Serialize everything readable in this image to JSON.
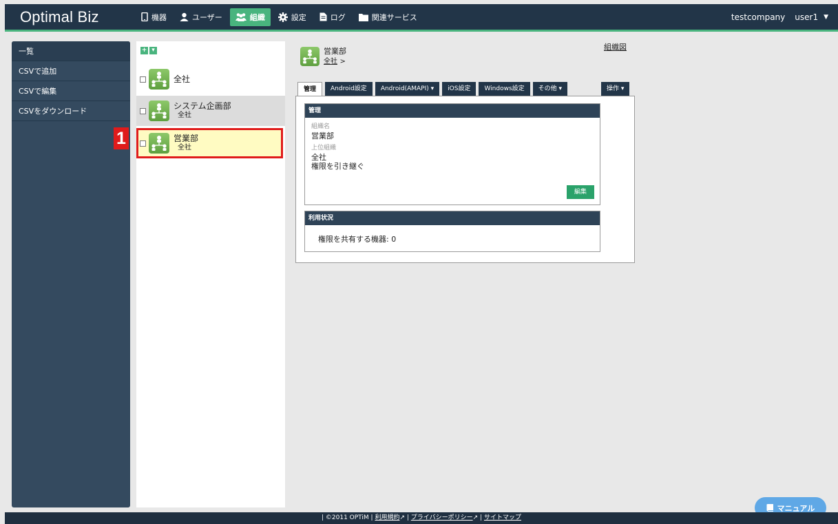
{
  "app": {
    "title": "Optimal Biz"
  },
  "nav": {
    "items": [
      {
        "label": "機器",
        "icon": "phone-icon",
        "active": false
      },
      {
        "label": "ユーザー",
        "icon": "user-icon",
        "active": false
      },
      {
        "label": "組織",
        "icon": "group-icon",
        "active": true
      },
      {
        "label": "設定",
        "icon": "gear-icon",
        "active": false
      },
      {
        "label": "ログ",
        "icon": "document-icon",
        "active": false
      },
      {
        "label": "関連サービス",
        "icon": "folder-icon",
        "active": false
      }
    ]
  },
  "user": {
    "company": "testcompany",
    "name": "user1"
  },
  "sidebar": {
    "items": [
      {
        "label": "一覧"
      },
      {
        "label": "CSVで追加"
      },
      {
        "label": "CSVで編集"
      },
      {
        "label": "CSVをダウンロード"
      }
    ]
  },
  "tree": {
    "tools": {
      "add": "+",
      "menu": "▾"
    },
    "nodes": [
      {
        "name": "全社",
        "parent": ""
      },
      {
        "name": "システム企画部",
        "parent": "全社"
      },
      {
        "name": "営業部",
        "parent": "全社"
      }
    ],
    "callout": "1"
  },
  "main": {
    "org_name": "営業部",
    "breadcrumb": "全社",
    "breadcrumb_sep": ">",
    "org_chart_link": "組織図",
    "tabs": [
      {
        "label": "管理"
      },
      {
        "label": "Android設定"
      },
      {
        "label": "Android(AMAPI) ▾"
      },
      {
        "label": "iOS設定"
      },
      {
        "label": "Windows設定"
      },
      {
        "label": "その他 ▾"
      }
    ],
    "operation_tab": "操作 ▾",
    "manage_box": {
      "header": "管理",
      "name_label": "組織名",
      "name_value": "営業部",
      "parent_label": "上位組織",
      "parent_value": "全社",
      "inherit_text": "権限を引き継ぐ",
      "edit_button": "編集"
    },
    "usage_box": {
      "header": "利用状況",
      "shared_devices": "権限を共有する機器: 0"
    }
  },
  "footer": {
    "copyright": "| ©2011 OPTiM |",
    "terms": "利用規約",
    "sep1": "|",
    "privacy": "プライバシーポリシー",
    "sep2": "|",
    "sitemap": "サイトマップ"
  },
  "manual_button": {
    "label": "マニュアル"
  }
}
